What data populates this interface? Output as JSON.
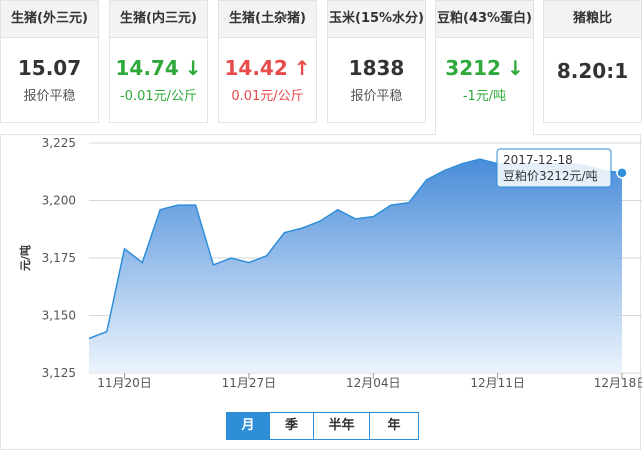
{
  "cards": [
    {
      "title": "生猪(外三元)",
      "value": "15.07",
      "sub": "报价平稳",
      "trend": "flat"
    },
    {
      "title": "生猪(内三元)",
      "value": "14.74",
      "arrow": "↓",
      "sub": "-0.01元/公斤",
      "trend": "down"
    },
    {
      "title": "生猪(土杂猪)",
      "value": "14.42",
      "arrow": "↑",
      "sub": "0.01元/公斤",
      "trend": "up"
    },
    {
      "title": "玉米(15%水分)",
      "value": "1838",
      "sub": "报价平稳",
      "trend": "flat"
    },
    {
      "title": "豆粕(43%蛋白)",
      "value": "3212",
      "arrow": "↓",
      "sub": "-1元/吨",
      "trend": "down"
    },
    {
      "title": "猪粮比",
      "value": "8.20:1",
      "sub": "",
      "trend": "flat"
    }
  ],
  "ranges": [
    "月",
    "季",
    "半年",
    "年"
  ],
  "active_range": "月",
  "colors": {
    "line": "#2e8ed8",
    "fill_top": "#4a8fdc",
    "fill_bottom": "#eef5fd",
    "up": "#e84b4b",
    "down": "#2faa3a"
  },
  "chart_data": {
    "type": "area",
    "title": "",
    "xlabel": "",
    "ylabel": "元/吨",
    "ylim": [
      3125,
      3225
    ],
    "yticks": [
      "3,125",
      "3,150",
      "3,175",
      "3,200",
      "3,225"
    ],
    "x": [
      "2017-11-18",
      "2017-11-19",
      "2017-11-20",
      "2017-11-21",
      "2017-11-22",
      "2017-11-23",
      "2017-11-24",
      "2017-11-25",
      "2017-11-26",
      "2017-11-27",
      "2017-11-28",
      "2017-11-29",
      "2017-11-30",
      "2017-12-01",
      "2017-12-02",
      "2017-12-03",
      "2017-12-04",
      "2017-12-05",
      "2017-12-06",
      "2017-12-07",
      "2017-12-08",
      "2017-12-09",
      "2017-12-10",
      "2017-12-11",
      "2017-12-12",
      "2017-12-13",
      "2017-12-14",
      "2017-12-15",
      "2017-12-16",
      "2017-12-17",
      "2017-12-18"
    ],
    "xticks": [
      "11月20日",
      "11月27日",
      "12月04日",
      "12月11日",
      "12月18日"
    ],
    "values": [
      3140,
      3143,
      3179,
      3173,
      3196,
      3198,
      3198,
      3172,
      3175,
      3173,
      3176,
      3186,
      3188,
      3191,
      3196,
      3192,
      3193,
      3198,
      3199,
      3209,
      3213,
      3216,
      3218,
      3216,
      3216,
      3216,
      3216,
      3216,
      3215,
      3213,
      3212
    ],
    "tooltip": {
      "date": "2017-12-18",
      "text": "豆粕价3212元/吨"
    },
    "grid": true,
    "legend": "none"
  }
}
